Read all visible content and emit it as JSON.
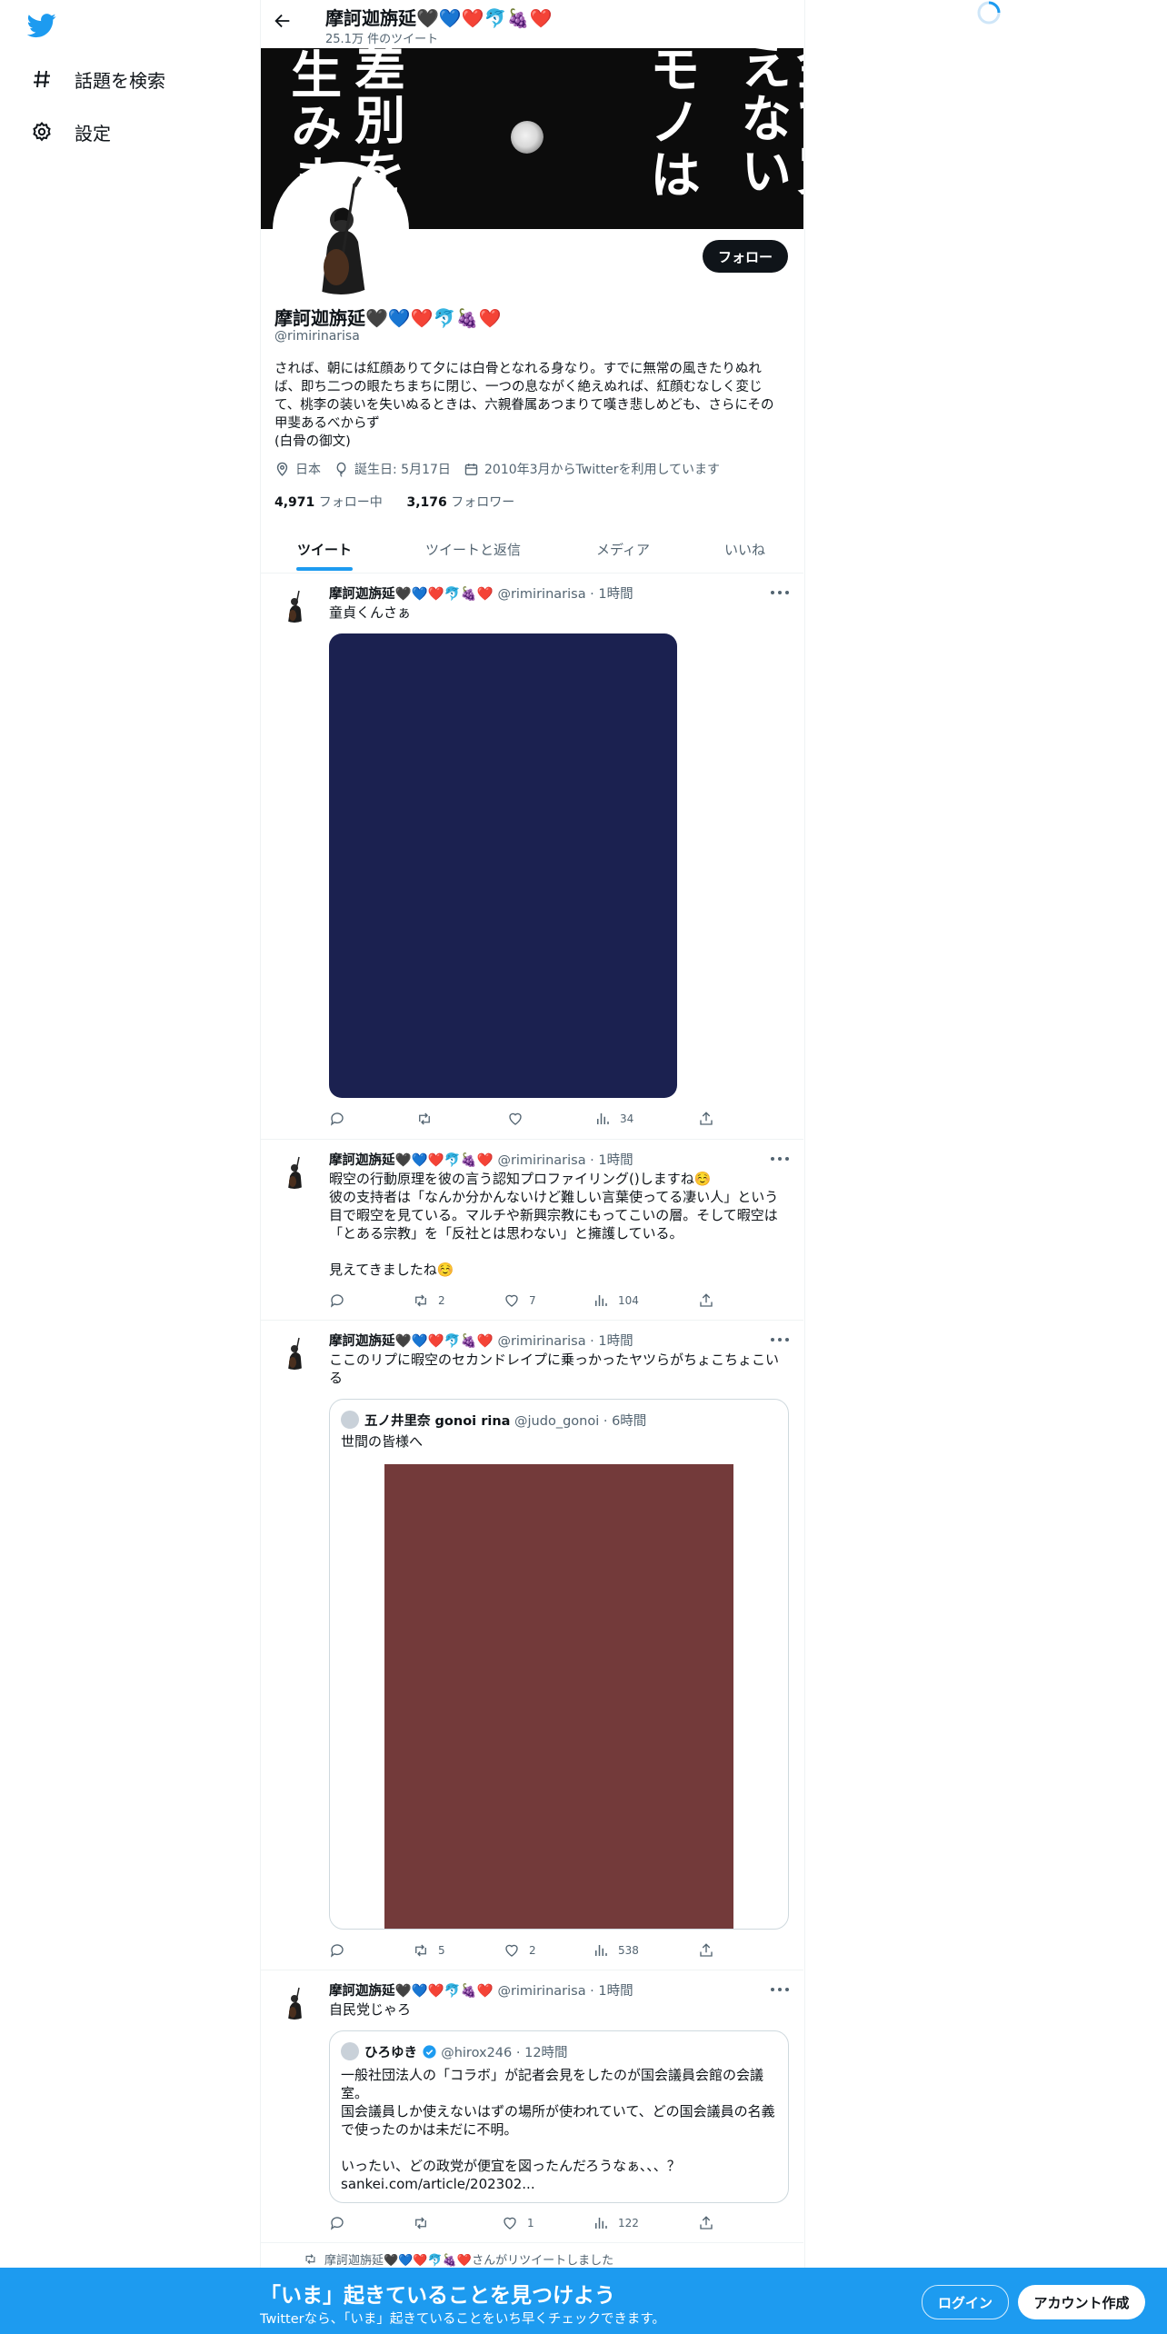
{
  "nav": {
    "items": [
      {
        "label": "話題を検索",
        "icon": "hashtag-icon"
      },
      {
        "label": "設定",
        "icon": "gear-icon"
      }
    ]
  },
  "header": {
    "name": "摩訶迦旃延🖤💙❤️🐬🍇❤️",
    "tweet_count": "25.1万 件のツイート"
  },
  "banner": {
    "text_cols": [
      "金で買えない",
      "モノは",
      "差別を",
      "生みま"
    ]
  },
  "profile": {
    "name": "摩訶迦旃延🖤💙❤️🐬🍇❤️",
    "handle": "@rimirinarisa",
    "follow_label": "フォロー",
    "bio": "されば、朝には紅顔ありて夕には白骨となれる身なり。すでに無常の風きたりぬれば、即ち二つの眼たちまちに閉じ、一つの息ながく絶えぬれば、紅顔むなしく変じて、桃李の装いを失いぬるときは、六親眷属あつまりて嘆き悲しめども、さらにその甲斐あるべからず\n(白骨の御文)",
    "location": "日本",
    "birthday": "誕生日: 5月17日",
    "joined": "2010年3月からTwitterを利用しています",
    "following_count": "4,971",
    "following_label": "フォロー中",
    "followers_count": "3,176",
    "followers_label": "フォロワー"
  },
  "tabs": [
    "ツイート",
    "ツイートと返信",
    "メディア",
    "いいね"
  ],
  "tweets": [
    {
      "name": "摩訶迦旃延🖤💙❤️🐬🍇❤️",
      "meta": "@rimirinarisa · 1時間",
      "text": "童貞くんさぁ",
      "media_color": "#1b2150",
      "reply": "",
      "retweet": "",
      "like": "",
      "views": "34"
    },
    {
      "name": "摩訶迦旃延🖤💙❤️🐬🍇❤️",
      "meta": "@rimirinarisa · 1時間",
      "text": "暇空の行動原理を彼の言う認知プロファイリング()しますね☺️\n彼の支持者は「なんか分かんないけど難しい言葉使ってる凄い人」という目で暇空を見ている。マルチや新興宗教にもってこいの層。そして暇空は「とある宗教」を「反社とは思わない」と擁護している。\n\n見えてきましたね☺️",
      "reply": "",
      "retweet": "2",
      "like": "7",
      "views": "104"
    },
    {
      "name": "摩訶迦旃延🖤💙❤️🐬🍇❤️",
      "meta": "@rimirinarisa · 1時間",
      "text": "ここのリプに暇空のセカンドレイプに乗っかったヤツらがちょこちょこいる",
      "quote": {
        "name": "五ノ井里奈 gonoi rina",
        "meta": "@judo_gonoi · 6時間",
        "text": "世間の皆様へ",
        "media_color": "#733a3a"
      },
      "reply": "",
      "retweet": "5",
      "like": "2",
      "views": "538"
    },
    {
      "name": "摩訶迦旃延🖤💙❤️🐬🍇❤️",
      "meta": "@rimirinarisa · 1時間",
      "text": "自民党じゃろ",
      "quote": {
        "name": "ひろゆき",
        "meta": "@hirox246 · 12時間",
        "text": "一般社団法人の「コラボ」が記者会見をしたのが国会議員会館の会議室。\n国会議員しか使えないはずの場所が使われていて、どの国会議員の名義で使ったのかは未だに不明。\n\nいったい、どの政党が便宜を図ったんだろうなぁ、、、？\nsankei.com/article/202302..."
      },
      "reply": "",
      "retweet": "",
      "like": "1",
      "views": "122"
    }
  ],
  "retweeted_notice": "摩訶迦旃延🖤💙❤️🐬🍇❤️さんがリツイートしました",
  "bottom_bar": {
    "title": "「いま」起きていることを見つけよう",
    "subtitle": "Twitterなら、「いま」起きていることをいち早くチェックできます。",
    "login": "ログイン",
    "signup": "アカウント作成"
  },
  "colors": {
    "accent": "#1d9bf0",
    "text": "#0f1419",
    "muted": "#536471"
  }
}
